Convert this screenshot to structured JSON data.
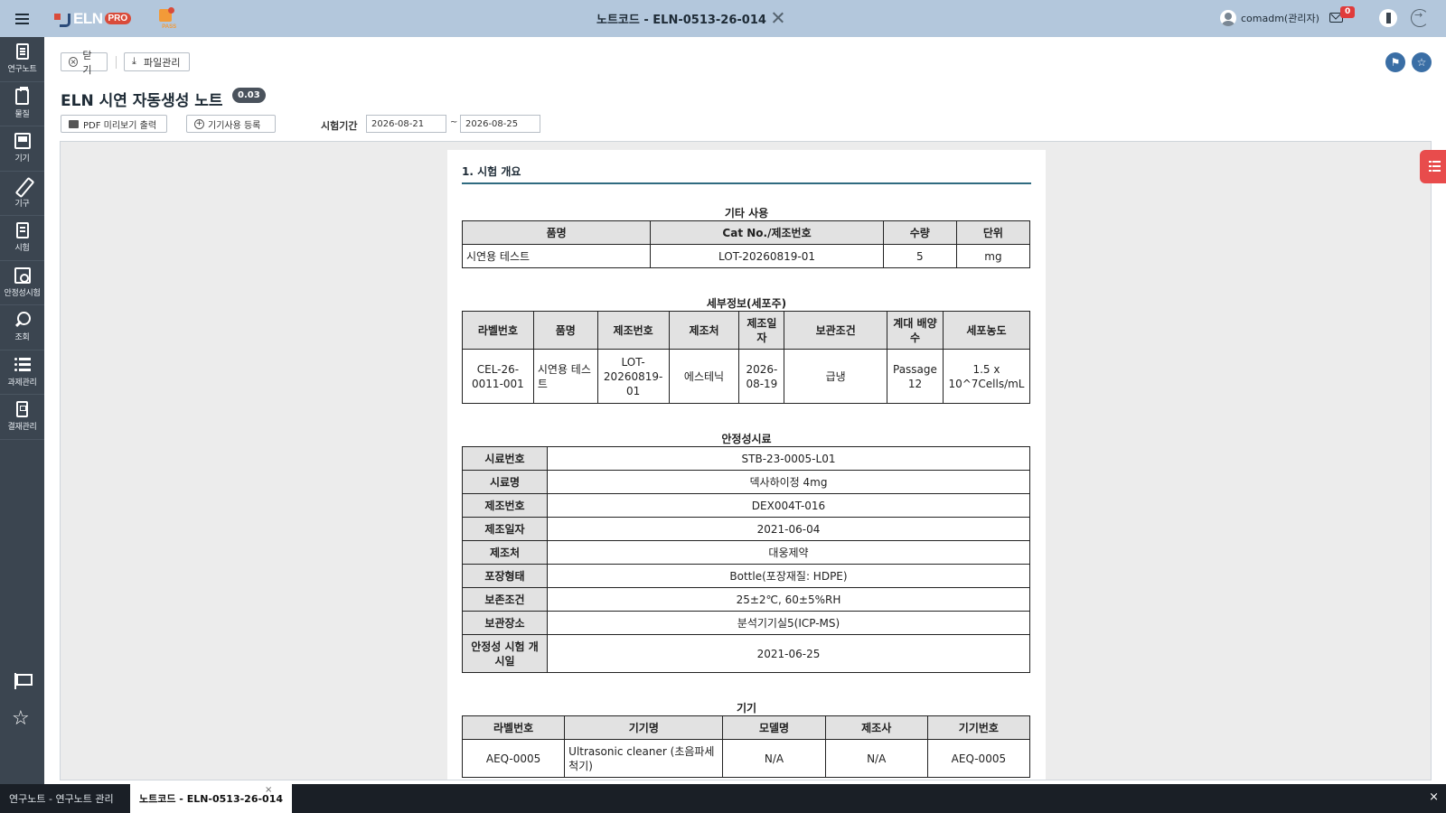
{
  "topbar": {
    "logo_text": "ELN",
    "logo_pro": "PRO",
    "logo2_text": "PASS",
    "note_title": "노트코드 - ELN-0513-26-014",
    "user": "comadm(관리자)",
    "mail_count": "0"
  },
  "sidebar": {
    "items": [
      {
        "label": "연구노트",
        "icon": "notebook-icon"
      },
      {
        "label": "물질",
        "icon": "clipboard-icon"
      },
      {
        "label": "기기",
        "icon": "device-icon"
      },
      {
        "label": "기구",
        "icon": "tool-icon"
      },
      {
        "label": "시험",
        "icon": "test-icon"
      },
      {
        "label": "안정성시험",
        "icon": "stability-icon"
      },
      {
        "label": "조회",
        "icon": "search-icon"
      },
      {
        "label": "과제관리",
        "icon": "list-icon"
      },
      {
        "label": "결재관리",
        "icon": "approval-icon"
      }
    ]
  },
  "toolbar": {
    "close_label": "닫기",
    "file_label": "파일관리"
  },
  "note": {
    "title": "ELN 시연 자동생성 노트",
    "version": "0.03",
    "pdf_label": "PDF 미리보기 출력",
    "equip_label": "기기사용 등록",
    "period_label": "시험기간",
    "start_date": "2026-08-21",
    "tilde": "~",
    "end_date": "2026-08-25"
  },
  "doc": {
    "section_title": "1. 시험 개요",
    "other": {
      "title": "기타 사용",
      "headers": [
        "품명",
        "Cat No./제조번호",
        "수량",
        "단위"
      ],
      "row": [
        "시연용 테스트",
        "LOT-20260819-01",
        "5",
        "mg"
      ]
    },
    "cell": {
      "title": "세부정보(세포주)",
      "headers": [
        "라벨번호",
        "품명",
        "제조번호",
        "제조처",
        "제조일자",
        "보관조건",
        "계대 배양수",
        "세포농도"
      ],
      "row": [
        "CEL-26-0011-001",
        "시연용 테스트",
        "LOT-20260819-01",
        "에스테닉",
        "2026-08-19",
        "급냉",
        "Passage 12",
        "1.5 x 10^7Cells/mL"
      ]
    },
    "stability": {
      "title": "안정성시료",
      "rows": [
        {
          "label": "시료번호",
          "value": "STB-23-0005-L01"
        },
        {
          "label": "시료명",
          "value": "덱사하이정 4mg"
        },
        {
          "label": "제조번호",
          "value": "DEX004T-016"
        },
        {
          "label": "제조일자",
          "value": "2021-06-04"
        },
        {
          "label": "제조처",
          "value": "대웅제약"
        },
        {
          "label": "포장형태",
          "value": "Bottle(포장재질: HDPE)"
        },
        {
          "label": "보존조건",
          "value": "25±2℃, 60±5%RH"
        },
        {
          "label": "보관장소",
          "value": "분석기기실5(ICP-MS)"
        },
        {
          "label": "안정성 시험 개시일",
          "value": "2021-06-25"
        }
      ]
    },
    "equipment": {
      "title": "기기",
      "headers": [
        "라벨번호",
        "기기명",
        "모델명",
        "제조사",
        "기기번호"
      ],
      "row": [
        "AEQ-0005",
        "Ultrasonic cleaner (초음파세척기)",
        "N/A",
        "N/A",
        "AEQ-0005"
      ]
    }
  },
  "bottom_tabs": [
    {
      "label": "연구노트 - 연구노트 관리"
    },
    {
      "label": "노트코드 - ELN-0513-26-014"
    }
  ],
  "colors": {
    "topbar": "#b3c7dc",
    "sidebar": "#3b4550",
    "accent": "#3a6ea5",
    "badge_red": "#e03b3b"
  }
}
